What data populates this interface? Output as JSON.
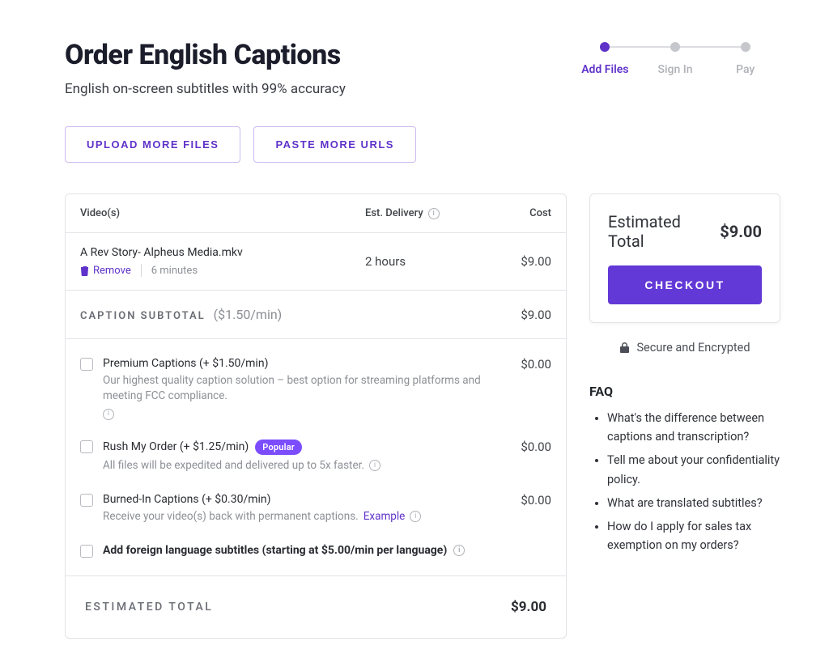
{
  "page": {
    "title": "Order English Captions",
    "subtitle": "English on-screen subtitles with 99% accuracy"
  },
  "stepper": {
    "steps": [
      {
        "label": "Add Files",
        "active": true
      },
      {
        "label": "Sign In",
        "active": false
      },
      {
        "label": "Pay",
        "active": false
      }
    ]
  },
  "buttons": {
    "upload": "Upload More Files",
    "paste": "Paste More URLs"
  },
  "table": {
    "headers": {
      "videos": "Video(s)",
      "delivery": "Est. Delivery",
      "cost": "Cost"
    },
    "rows": [
      {
        "name": "A Rev Story- Alpheus Media.mkv",
        "remove": "Remove",
        "duration": "6 minutes",
        "delivery": "2 hours",
        "cost": "$9.00"
      }
    ],
    "subtotal": {
      "label": "CAPTION SUBTOTAL",
      "rate": "($1.50/min)",
      "value": "$9.00"
    }
  },
  "options": [
    {
      "name": "premium",
      "title": "Premium Captions (+ $1.50/min)",
      "desc": "Our highest quality caption solution – best option for streaming platforms and meeting FCC compliance.",
      "price": "$0.00",
      "badge": null,
      "hasInfo": true
    },
    {
      "name": "rush",
      "title": "Rush My Order (+ $1.25/min)",
      "desc": "All files will be expedited and delivered up to 5x faster.",
      "price": "$0.00",
      "badge": "Popular",
      "hasInfo": true
    },
    {
      "name": "burned",
      "title": "Burned-In Captions (+ $0.30/min)",
      "desc": "Receive your video(s) back with permanent captions.",
      "exampleLink": "Example",
      "price": "$0.00",
      "badge": null,
      "hasInfo": true
    }
  ],
  "foreign": {
    "title": "Add foreign language subtitles (starting at $5.00/min per language)",
    "hasInfo": true
  },
  "totals": {
    "estimatedLabel": "ESTIMATED TOTAL",
    "estimatedValue": "$9.00"
  },
  "sidebar": {
    "estLabel": "Estimated Total",
    "estValue": "$9.00",
    "checkout": "CHECKOUT",
    "secure": "Secure and Encrypted",
    "faqHead": "FAQ",
    "faq": [
      "What's the difference between captions and transcription?",
      "Tell me about your confidentiality policy.",
      "What are translated subtitles?",
      "How do I apply for sales tax exemption on my orders?"
    ]
  },
  "icons": {
    "info": "i",
    "trash": "trash-icon",
    "lock": "lock-icon"
  }
}
